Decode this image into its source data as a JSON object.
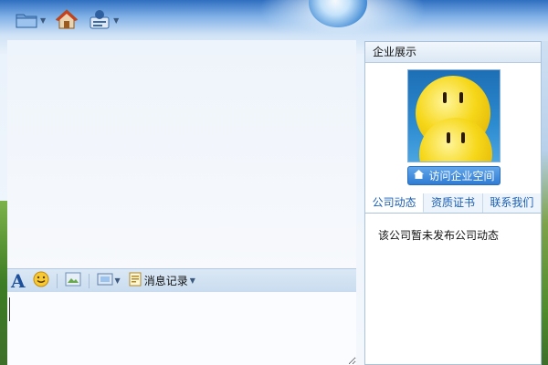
{
  "toolbar": {
    "items": [
      {
        "icon": "folder-icon"
      },
      {
        "icon": "home-icon"
      },
      {
        "icon": "user-card-icon"
      }
    ]
  },
  "input_toolbar": {
    "history_label": "消息记录"
  },
  "side_panel": {
    "title": "企业展示",
    "visit_button": "访问企业空间",
    "tabs": [
      "公司动态",
      "资质证书",
      "联系我们"
    ],
    "news_text": "该公司暂未发布公司动态"
  }
}
